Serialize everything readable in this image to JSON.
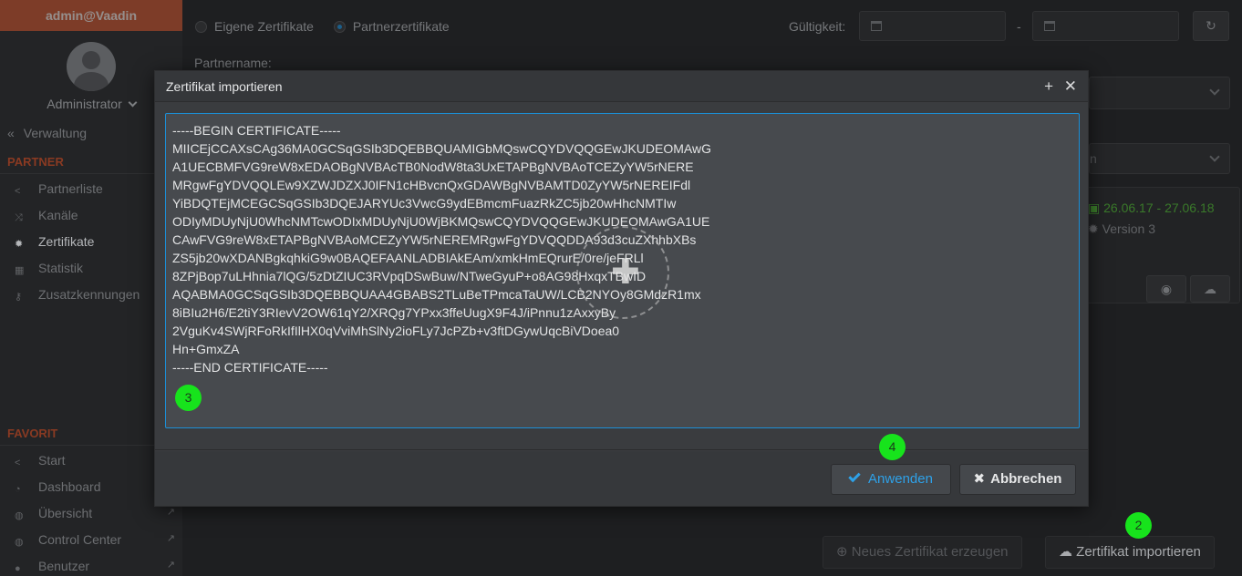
{
  "sidebar": {
    "user": "admin@Vaadin",
    "role": "Administrator",
    "back": "Verwaltung",
    "section_partner": "PARTNER",
    "partner_items": [
      {
        "label": "Partnerliste",
        "icon": "share-icon"
      },
      {
        "label": "Kanäle",
        "icon": "shuffle-icon"
      },
      {
        "label": "Zertifikate",
        "icon": "certificate-icon"
      },
      {
        "label": "Statistik",
        "icon": "calendar-icon"
      },
      {
        "label": "Zusatzkennungen",
        "icon": "key-icon"
      }
    ],
    "section_favorit": "FAVORIT",
    "favorit_items": [
      {
        "label": "Start",
        "icon": "share-icon"
      },
      {
        "label": "Dashboard",
        "icon": "dashboard-icon"
      },
      {
        "label": "Übersicht",
        "icon": "globe-icon"
      },
      {
        "label": "Control Center",
        "icon": "globe-icon"
      },
      {
        "label": "Benutzer",
        "icon": "users-icon"
      }
    ]
  },
  "main": {
    "radio_own": "Eigene Zertifikate",
    "radio_partner": "Partnerzertifikate",
    "validity_label": "Gültigkeit:",
    "date_separator": "-",
    "partnername_label": "Partnername:",
    "dropdown2_value": "n",
    "card_dates": "26.06.17 - 27.06.18",
    "card_version": "Version 3",
    "btn_new_cert": "Neues Zertifikat erzeugen",
    "btn_import_cert": "Zertifikat importieren"
  },
  "dialog": {
    "title": "Zertifikat importieren",
    "certificate_text": "-----BEGIN CERTIFICATE-----\nMIICEjCCAXsCAg36MA0GCSqGSIb3DQEBBQUAMIGbMQswCQYDVQQGEwJKUDEOMAwG\nA1UECBMFVG9reW8xEDAOBgNVBAcTB0NodW8ta3UxETAPBgNVBAoTCEZyYW5rNERE\nMRgwFgYDVQQLEw9XZWJDZXJ0IFN1cHBvcnQxGDAWBgNVBAMTD0ZyYW5rNEREIFdl\nYiBDQTEjMCEGCSqGSIb3DQEJARYUc3VwcG9ydEBmcmFuazRkZC5jb20wHhcNMTIw\nODIyMDUyNjU0WhcNMTcwODIxMDUyNjU0WjBKMQswCQYDVQQGEwJKUDEOMAwGA1UE\nCAwFVG9reW8xETAPBgNVBAoMCEZyYW5rNEREMRgwFgYDVQQDDA93d3cuZXhhbXBs\nZS5jb20wXDANBgkqhkiG9w0BAQEFAANLADBIAkEAm/xmkHmEQrurE/0re/jeFRLl\n8ZPjBop7uLHhnia7lQG/5zDtZIUC3RVpqDSwBuw/NTweGyuP+o8AG98HxqxTBwID\nAQABMA0GCSqGSIb3DQEBBQUAA4GBABS2TLuBeTPmcaTaUW/LCB2NYOy8GMdzR1mx\n8iBIu2H6/E2tiY3RIevV2OW61qY2/XRQg7YPxx3ffeUugX9F4J/iPnnu1zAxxyBy\n2VguKv4SWjRFoRkIfIlHX0qVviMhSlNy2ioFLy7JcPZb+v3ftDGywUqcBiVDoea0\nHn+GmxZA\n-----END CERTIFICATE-----",
    "btn_apply": "Anwenden",
    "btn_cancel": "Abbrechen"
  },
  "badges": {
    "b2": "2",
    "b3": "3",
    "b4": "4"
  },
  "colors": {
    "accent": "#2ea1e8",
    "brand": "#c8502a",
    "badge": "#17e31c"
  }
}
